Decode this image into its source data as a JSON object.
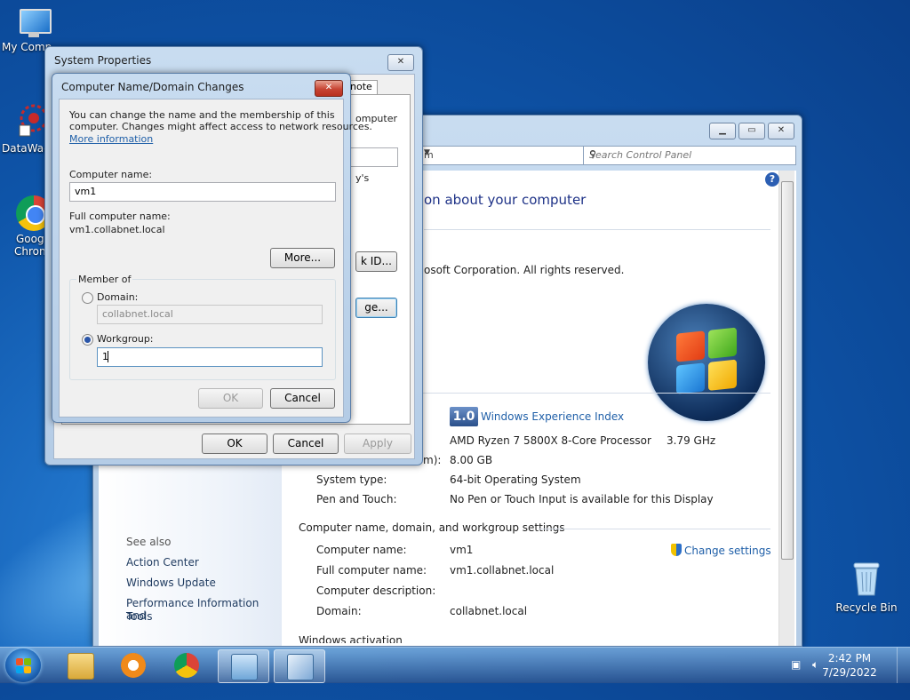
{
  "desktop": {
    "icons": [
      {
        "label": "My Comp",
        "icon": "computer-icon"
      },
      {
        "label": "DataWag",
        "icon": "datawagon-icon"
      },
      {
        "label": "Googl",
        "label2": "Chron",
        "icon": "chrome-icon"
      },
      {
        "label": "Recycle Bin",
        "icon": "recycle-bin-icon"
      }
    ]
  },
  "control_panel": {
    "address_text": "m",
    "search_placeholder": "Search Control Panel",
    "heading": "on about your computer",
    "copyright": "osoft Corporation.  All rights reserved.",
    "wei": {
      "score": "1.0",
      "link": "Windows Experience Index"
    },
    "processor": {
      "value": "AMD Ryzen 7 5800X 8-Core Processor",
      "speed": "3.79 GHz"
    },
    "ram": {
      "label_fragment": "m):",
      "value": "8.00 GB"
    },
    "system_type": {
      "label": "System type:",
      "value": "64-bit Operating System"
    },
    "pen_touch": {
      "label": "Pen and Touch:",
      "value": "No Pen or Touch Input is available for this Display"
    },
    "section_name": "Computer name, domain, and workgroup settings",
    "computer_name": {
      "label": "Computer name:",
      "value": "vm1"
    },
    "full_name": {
      "label": "Full computer name:",
      "value": "vm1.collabnet.local"
    },
    "description": {
      "label": "Computer description:",
      "value": ""
    },
    "domain": {
      "label": "Domain:",
      "value": "collabnet.local"
    },
    "change_settings": "Change settings",
    "see_also": "See also",
    "left_links": [
      "Action Center",
      "Windows Update",
      "Performance Information and",
      "Tools"
    ],
    "bottom_fragment": "Windows activation"
  },
  "system_properties": {
    "title": "System Properties",
    "tab_fragment": "note",
    "text_fragments": [
      "omputer",
      "y's"
    ],
    "network_id_fragment": "k ID...",
    "change_fragment": "ge...",
    "ok": "OK",
    "cancel": "Cancel",
    "apply": "Apply"
  },
  "name_dialog": {
    "title": "Computer Name/Domain Changes",
    "intro_line1": "You can change the name and the membership of this",
    "intro_line2": "computer. Changes might affect access to network resources.",
    "more_info": "More information",
    "computer_name_label": "Computer name:",
    "computer_name_value": "vm1",
    "full_name_label": "Full computer name:",
    "full_name_value": "vm1.collabnet.local",
    "more_button": "More...",
    "member_of": "Member of",
    "domain_label": "Domain:",
    "domain_value": "collabnet.local",
    "workgroup_label": "Workgroup:",
    "workgroup_value": "1",
    "workgroup_selected": true,
    "ok": "OK",
    "cancel": "Cancel"
  },
  "taskbar": {
    "time": "2:42 PM",
    "date": "7/29/2022",
    "items": [
      "explorer-icon",
      "media-player-icon",
      "chrome-icon",
      "control-panel-icon",
      "system-properties-icon"
    ]
  },
  "colors": {
    "link": "#1f5fa8",
    "heading": "#1e3287",
    "desktop": "#0e54a8"
  }
}
